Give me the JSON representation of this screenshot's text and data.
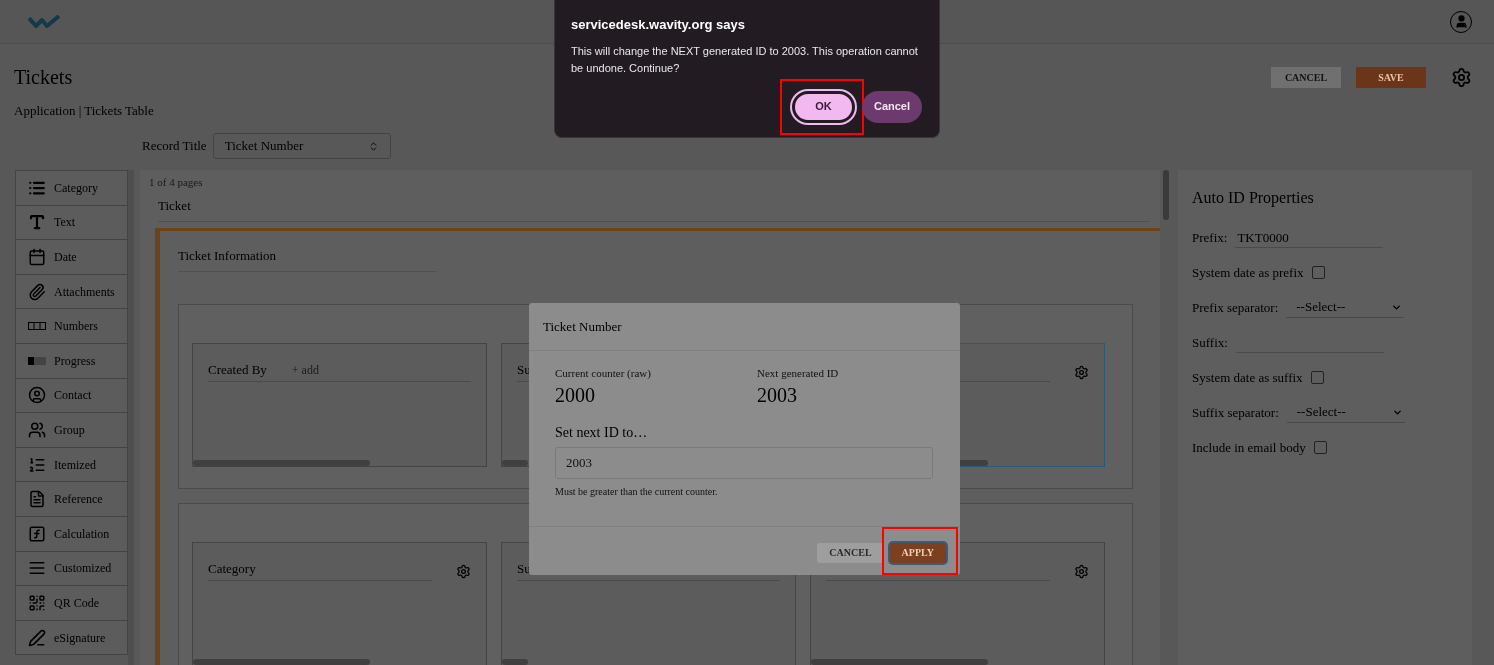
{
  "page": {
    "title": "Tickets",
    "breadcrumb": "Application | Tickets Table",
    "record_title_label": "Record Title",
    "record_title_value": "Ticket Number"
  },
  "actions": [
    {
      "label": "CANCEL",
      "kind": "secondary"
    },
    {
      "label": "SAVE",
      "kind": "primary"
    }
  ],
  "palette": [
    {
      "label": "Category",
      "kind": "list"
    },
    {
      "label": "Text",
      "kind": "text"
    },
    {
      "label": "Date",
      "kind": "date"
    },
    {
      "label": "Attachments",
      "kind": "attachment"
    },
    {
      "label": "Numbers",
      "kind": "number"
    },
    {
      "label": "Progress",
      "kind": "progress"
    },
    {
      "label": "Contact",
      "kind": "contact"
    },
    {
      "label": "Group",
      "kind": "group"
    },
    {
      "label": "Itemized",
      "kind": "itemized"
    },
    {
      "label": "Reference",
      "kind": "reference"
    },
    {
      "label": "Calculation",
      "kind": "calculation"
    },
    {
      "label": "Customized",
      "kind": "customized"
    },
    {
      "label": "QR Code",
      "kind": "qr"
    },
    {
      "label": "eSignature",
      "kind": "signature"
    }
  ],
  "canvas": {
    "pages": "1 of 4 pages",
    "tab": "Ticket",
    "section": "Ticket Information",
    "cards": [
      {
        "fields": [
          {
            "label": "Created By",
            "add": "+ add",
            "gear": false,
            "selected": false
          },
          {
            "label": "Su",
            "selected": false
          },
          {
            "gear": true,
            "selected": true
          }
        ]
      },
      {
        "fields": [
          {
            "label": "Category",
            "gear": true,
            "selected": false
          },
          {
            "label": "Su",
            "selected": false
          },
          {
            "gear": true,
            "selected": false
          }
        ]
      }
    ]
  },
  "properties": {
    "title": "Auto ID Properties",
    "rows": [
      {
        "kind": "text",
        "label": "Prefix:",
        "value": "TKT0000"
      },
      {
        "kind": "checkbox",
        "label": "System date as prefix",
        "checked": false
      },
      {
        "kind": "select",
        "label": "Prefix separator:",
        "value": "--Select--"
      },
      {
        "kind": "text",
        "label": "Suffix:"
      },
      {
        "kind": "checkbox",
        "label": "System date as suffix",
        "checked": false
      },
      {
        "kind": "select",
        "label": "Suffix separator:",
        "value": "--Select--"
      },
      {
        "kind": "checkbox",
        "label": "Include in email body",
        "checked": false
      }
    ]
  },
  "modal": {
    "title": "Ticket Number",
    "stats": [
      {
        "label": "Current counter (raw)",
        "value": "2000"
      },
      {
        "label": "Next generated ID",
        "value": "2003"
      }
    ],
    "input_label": "Set next ID to…",
    "input_value": "2003",
    "help": "Must be greater than the current counter.",
    "buttons": [
      {
        "label": "CANCEL",
        "kind": "secondary",
        "highlighted": false
      },
      {
        "label": "APPLY",
        "kind": "primary",
        "highlighted": true
      }
    ]
  },
  "browser_dialog": {
    "title": "servicedesk.wavity.org says",
    "message": "This will change the NEXT generated ID to 2003. This operation cannot be undone. Continue?",
    "buttons": [
      {
        "label": "OK",
        "kind": "primary",
        "highlighted": true
      },
      {
        "label": "Cancel",
        "kind": "secondary",
        "highlighted": false
      }
    ]
  }
}
